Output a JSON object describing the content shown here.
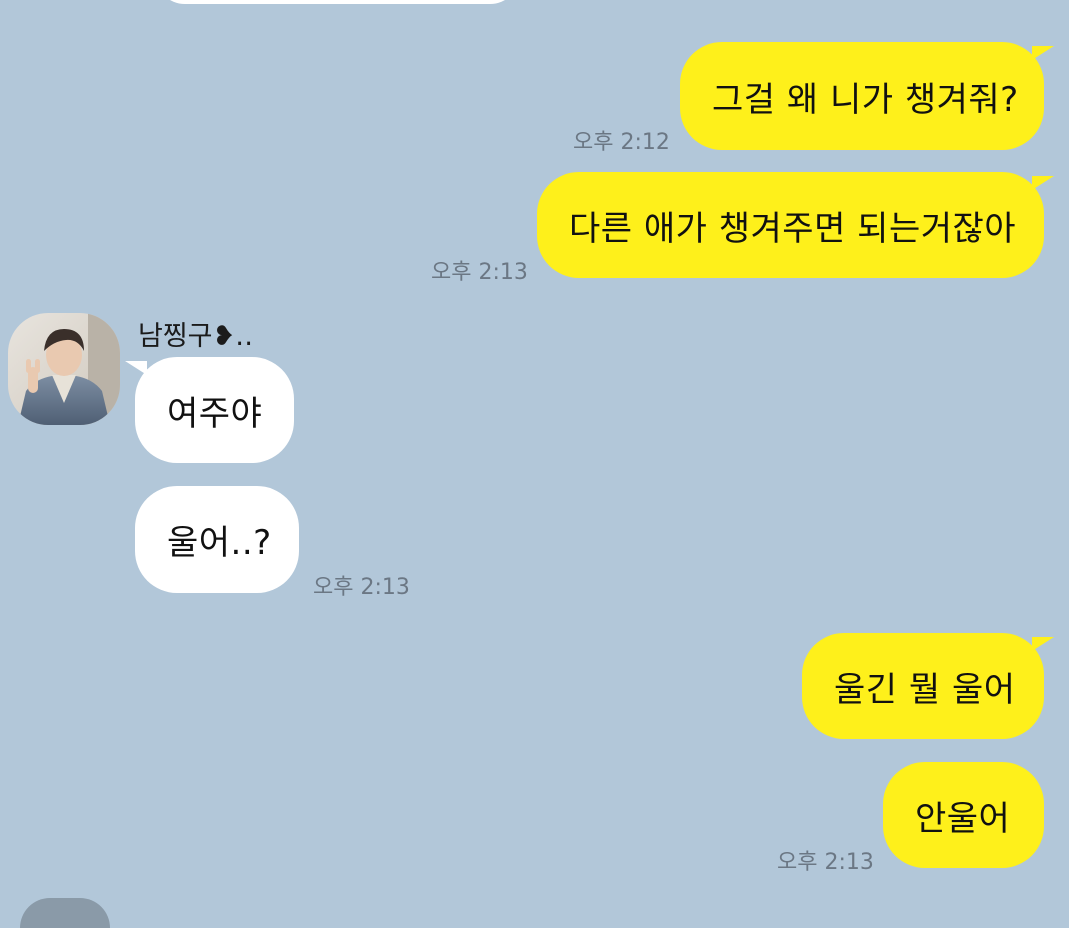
{
  "chat": {
    "messages": [
      {
        "from": "me",
        "text": "그걸 왜 니가 챙겨줘?",
        "time": "오후 2:12"
      },
      {
        "from": "me",
        "text": "다른 애가 챙겨주면 되는거잖아",
        "time": "오후 2:13"
      },
      {
        "from": "friend",
        "sender": "남찡구❥‥",
        "text": "여주야"
      },
      {
        "from": "friend",
        "text": "울어..?",
        "time": "오후 2:13"
      },
      {
        "from": "me",
        "text": "울긴 뭘 울어"
      },
      {
        "from": "me",
        "text": "안울어",
        "time": "오후 2:13"
      }
    ]
  },
  "colors": {
    "background": "#b2c7d9",
    "my_bubble": "#fef01b",
    "friend_bubble": "#ffffff",
    "timestamp": "#6b7784"
  },
  "icons": {
    "friend_avatar": "profile-photo"
  }
}
